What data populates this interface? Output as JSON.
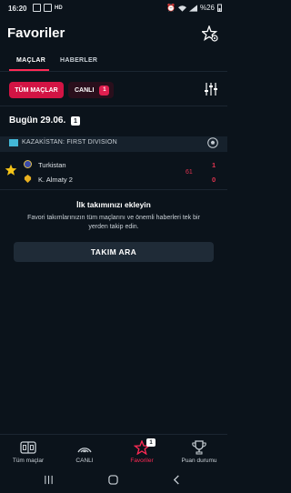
{
  "status_bar": {
    "time": "16:20",
    "battery": "%26"
  },
  "header": {
    "title": "Favoriler"
  },
  "tabs": [
    {
      "label": "MAÇLAR"
    },
    {
      "label": "HABERLER"
    }
  ],
  "filters": {
    "all_label": "TÜM MAÇLAR",
    "live_label": "CANLI",
    "live_count": "1"
  },
  "date_section": {
    "title": "Bugün 29.06.",
    "count": "1"
  },
  "league": {
    "name": "KAZAKİSTAN: FIRST DIVISION"
  },
  "match": {
    "minute": "61",
    "home": {
      "name": "Turkistan",
      "score": "1"
    },
    "away": {
      "name": "K. Almaty 2",
      "score": "0"
    }
  },
  "empty_state": {
    "title": "İlk takımınızı ekleyin",
    "text": "Favori takımlarınızın tüm maçlarını ve önemli haberleri tek bir yerden takip edin.",
    "button": "TAKIM ARA"
  },
  "bottom_nav": [
    {
      "label": "Tüm maçlar",
      "icon": "scoreboard-icon"
    },
    {
      "label": "CANLI",
      "icon": "live-signal-icon"
    },
    {
      "label": "Favoriler",
      "icon": "star-icon",
      "badge": "1"
    },
    {
      "label": "Puan durumu",
      "icon": "trophy-icon"
    }
  ],
  "colors": {
    "accent": "#d21444",
    "background": "#0b131b",
    "live": "#e0334f"
  }
}
